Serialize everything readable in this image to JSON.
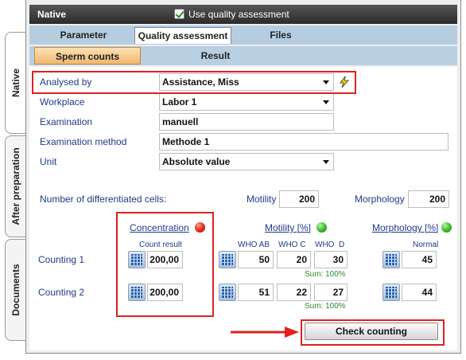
{
  "sidebar": {
    "tabs": [
      {
        "label": "Native",
        "active": true
      },
      {
        "label": "After preparation",
        "active": false
      },
      {
        "label": "Documents",
        "active": false
      }
    ]
  },
  "header": {
    "title": "Native",
    "use_quality_label": "Use quality assessment",
    "use_quality_checked": true
  },
  "tabs": [
    {
      "label": "Parameter",
      "active": false
    },
    {
      "label": "Quality assessment",
      "active": true
    },
    {
      "label": "Files",
      "active": false
    }
  ],
  "subtabs": [
    {
      "label": "Sperm counts",
      "active": true
    },
    {
      "label": "Result",
      "active": false
    }
  ],
  "form": {
    "analysed_by": {
      "label": "Analysed by",
      "value": "Assistance, Miss"
    },
    "workplace": {
      "label": "Workplace",
      "value": "Labor 1"
    },
    "examination": {
      "label": "Examination",
      "value": "manuell"
    },
    "examination_method": {
      "label": "Examination method",
      "value": "Methode 1"
    },
    "unit": {
      "label": "Unit",
      "value": "Absolute value"
    }
  },
  "differentiated": {
    "label": "Number of differentiated cells:",
    "motility_label": "Motility",
    "motility_value": "200",
    "morphology_label": "Morphology",
    "morphology_value": "200"
  },
  "sections": {
    "concentration": {
      "label": "Concentration",
      "status": "red",
      "sub": "Count result"
    },
    "motility": {
      "label": "Motility [%]",
      "status": "green",
      "cols": [
        "WHO AB",
        "WHO C",
        "WHO  D"
      ]
    },
    "morphology": {
      "label": "Morphology [%]",
      "status": "green",
      "sub": "Normal"
    }
  },
  "countings": [
    {
      "label": "Counting 1",
      "concentration": "200,00",
      "who_ab": "50",
      "who_c": "20",
      "who_d": "30",
      "sum": "Sum: 100%",
      "normal": "45"
    },
    {
      "label": "Counting 2",
      "concentration": "200,00",
      "who_ab": "51",
      "who_c": "22",
      "who_d": "27",
      "sum": "Sum: 100%",
      "normal": "44"
    }
  ],
  "check_button": "Check counting",
  "colors": {
    "highlight": "#e21f1f",
    "accent_tab": "#f1b770",
    "tab_bar": "#b6cde0"
  }
}
